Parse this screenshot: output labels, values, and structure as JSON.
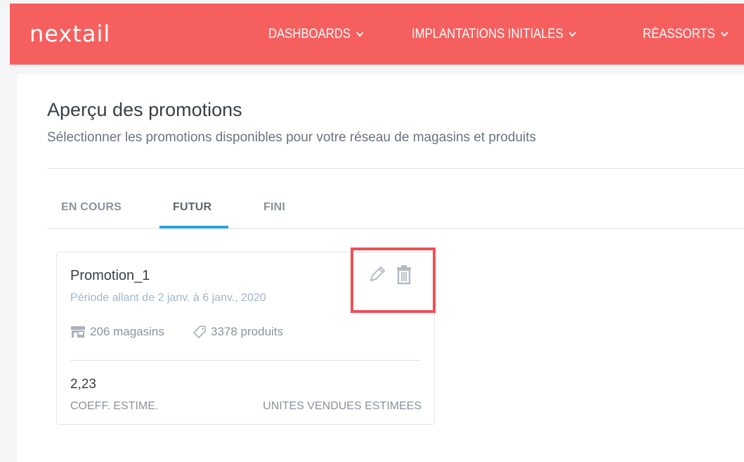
{
  "header": {
    "logo_text": "nextail",
    "nav": [
      {
        "label": "DASHBOARDS"
      },
      {
        "label": "IMPLANTATIONS INITIALES"
      },
      {
        "label": "RÉASSORTS"
      }
    ]
  },
  "page": {
    "title": "Aperçu des promotions",
    "subtitle": "Sélectionner les promotions disponibles pour votre réseau de magasins et produits"
  },
  "tabs": [
    {
      "label": "EN COURS",
      "active": false
    },
    {
      "label": "FUTUR",
      "active": true
    },
    {
      "label": "FINI",
      "active": false
    }
  ],
  "promotion_card": {
    "name": "Promotion_1",
    "period": "Période allant de 2 janv. à 6 janv., 2020",
    "stores": "206 magasins",
    "products": "3378 produits",
    "coeff_value": "2,23",
    "coeff_label": "COEFF. ESTIME.",
    "units_label": "UNITES VENDUES ESTIMEES",
    "actions": {
      "edit_icon": "pencil-icon",
      "delete_icon": "trash-icon"
    }
  },
  "colors": {
    "brand": "#f5605f",
    "tab_active_underline": "#2aa3dc",
    "highlight_box": "#ef4f57"
  }
}
